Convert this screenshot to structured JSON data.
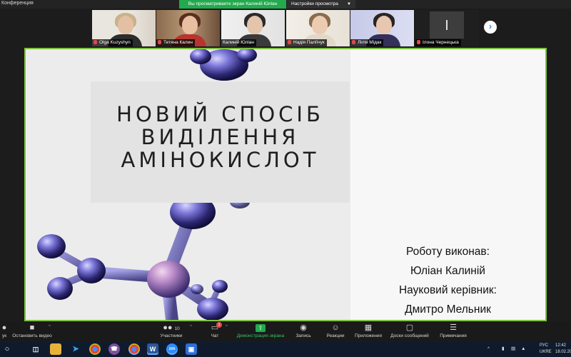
{
  "window": {
    "title": "Конференция"
  },
  "share_banner": {
    "text": "Вы просматриваете экран Калиній Юліан",
    "view_options": "Настройки просмотра"
  },
  "participants": [
    {
      "name": "Olga Kuzyshyn",
      "muted": true
    },
    {
      "name": "Тетяна Калин",
      "muted": true
    },
    {
      "name": "Калиній Юліан",
      "muted": false
    },
    {
      "name": "Надія Паліїчук",
      "muted": true
    },
    {
      "name": "Лілія Мідак",
      "muted": true
    },
    {
      "name": "Ілона Чернецька",
      "muted": true
    }
  ],
  "slide": {
    "title_lines": [
      "НОВИЙ СПОСІБ",
      "ВИДІЛЕННЯ",
      "АМІНОКИСЛОТ"
    ],
    "author_label": "Роботу виконав:",
    "author_name": "Юліан Калиній",
    "supervisor_label": "Науковий керівник:",
    "supervisor_name": "Дмитро Мельник"
  },
  "controls": {
    "mute_label": "ук",
    "stop_video": "Остановить видео",
    "participants": "Участники",
    "participants_count": "10",
    "chat": "Чат",
    "chat_badge": "1",
    "share_screen": "Демонстрация экрана",
    "record": "Запись",
    "reactions": "Реакции",
    "apps": "Приложения",
    "whiteboards": "Доски сообщений",
    "notes": "Примечания"
  },
  "taskbar": {
    "language": "РУС",
    "layout": "UKRE",
    "time": "12:42",
    "date": "18.02.20"
  },
  "colors": {
    "share_green": "#23a94e",
    "slide_border": "#7fc23f",
    "zoom_blue": "#2d8cff",
    "taskbar_bg": "#0f1b2d"
  }
}
